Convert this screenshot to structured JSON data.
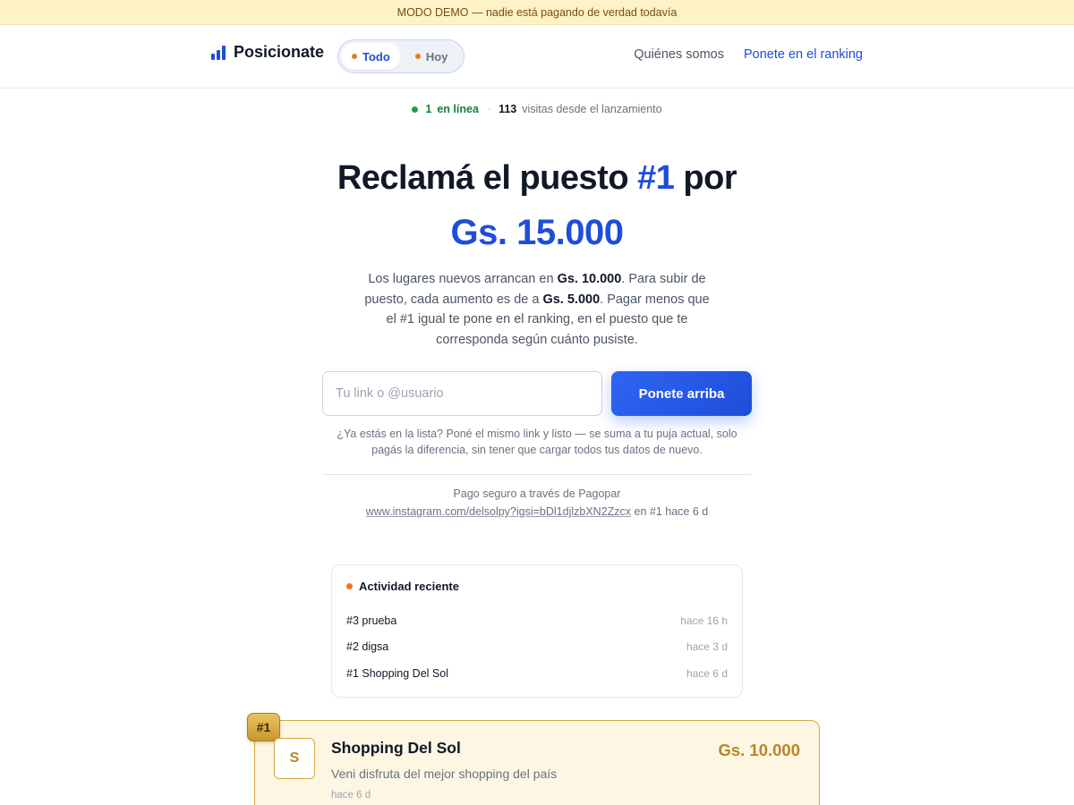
{
  "demo_banner": "MODO DEMO — nadie está pagando de verdad todavía",
  "header": {
    "brand": "Posicionate",
    "tabs": [
      {
        "label": "Todo",
        "active": true
      },
      {
        "label": "Hoy",
        "active": false
      }
    ],
    "nav": {
      "about": "Quiénes somos",
      "rank": "Ponete en el ranking"
    }
  },
  "stats": {
    "online_count": "1",
    "online_label": "en línea",
    "separator": "·",
    "visits_count": "113",
    "visits_label": "visitas desde el lanzamiento"
  },
  "hero": {
    "title_prefix": "Reclamá el puesto ",
    "title_accent": "#1",
    "title_suffix": " por",
    "price": "Gs. 15.000",
    "desc_1": "Los lugares nuevos arrancan en ",
    "desc_min": "Gs. 10.000",
    "desc_2": ". Para subir de puesto, cada aumento es de a ",
    "desc_step": "Gs. 5.000",
    "desc_3": ". Pagar menos que el #1 igual te pone en el ranking, en el puesto que te corresponda según cuánto pusiste."
  },
  "form": {
    "input_value": "",
    "input_placeholder": "Tu link o @usuario",
    "cta_label": "Ponete arriba",
    "hint": "¿Ya estás en la lista? Poné el mismo link y listo — se suma a tu puja actual, solo pagás la diferencia, sin tener que cargar todos tus datos de nuevo."
  },
  "payment": {
    "secure": "Pago seguro a través de Pagopar",
    "recent_link": "www.instagram.com/delsolpy?igsi=bDl1djlzbXN2Zzcx",
    "recent_suffix": " en #1 hace 6 d"
  },
  "activity": {
    "title": "Actividad reciente",
    "items": [
      {
        "name": "#3 prueba",
        "time": "hace 16 h"
      },
      {
        "name": "#2 digsa",
        "time": "hace 3 d"
      },
      {
        "name": "#1 Shopping Del Sol",
        "time": "hace 6 d"
      }
    ]
  },
  "top_entry": {
    "rank": "#1",
    "avatar": "S",
    "name": "Shopping Del Sol",
    "description": "Veni disfruta del mejor shopping del país",
    "time": "hace 6 d",
    "price": "Gs. 10.000"
  },
  "colors": {
    "accent": "#1d4ed8",
    "gold": "#b8862a",
    "online": "#16a34a",
    "activity_dot": "#f97316"
  }
}
